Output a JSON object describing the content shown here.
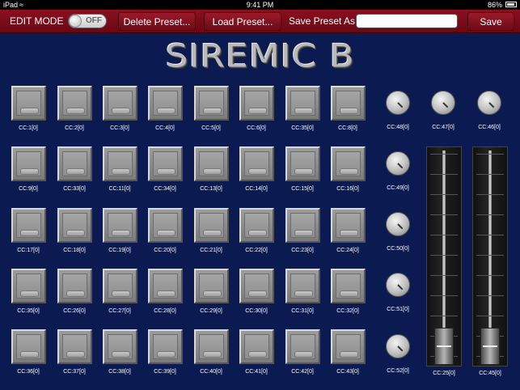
{
  "status": {
    "carrier": "iPad",
    "time": "9:41 PM",
    "battery": "86%"
  },
  "toolbar": {
    "edit_mode_label": "EDIT MODE",
    "toggle_state": "OFF",
    "delete_label": "Delete Preset...",
    "load_label": "Load Preset...",
    "save_as_label": "Save Preset As:",
    "preset_name_value": "",
    "save_label": "Save"
  },
  "title": "SIREMIC B",
  "pads": [
    [
      "CC:1[0]",
      "CC:2[0]",
      "CC:3[0]",
      "CC:4[0]",
      "CC:5[0]",
      "CC:6[0]",
      "CC:35[0]",
      "CC:8[0]"
    ],
    [
      "CC:9[0]",
      "CC:33[0]",
      "CC:11[0]",
      "CC:34[0]",
      "CC:13[0]",
      "CC:14[0]",
      "CC:15[0]",
      "CC:16[0]"
    ],
    [
      "CC:17[0]",
      "CC:18[0]",
      "CC:19[0]",
      "CC:20[0]",
      "CC:21[0]",
      "CC:22[0]",
      "CC:23[0]",
      "CC:24[0]"
    ],
    [
      "CC:35[0]",
      "CC:26[0]",
      "CC:27[0]",
      "CC:28[0]",
      "CC:29[0]",
      "CC:30[0]",
      "CC:31[0]",
      "CC:32[0]"
    ],
    [
      "CC:36[0]",
      "CC:37[0]",
      "CC:38[0]",
      "CC:39[0]",
      "CC:40[0]",
      "CC:41[0]",
      "CC:42[0]",
      "CC:43[0]"
    ]
  ],
  "knobs": {
    "top_row": [
      "CC:48[0]",
      "CC:47[0]",
      "CC:46[0]"
    ],
    "column": [
      "CC:49[0]",
      "CC:50[0]",
      "CC:51[0]",
      "CC:52[0]"
    ]
  },
  "faders": [
    {
      "label": "CC:25[0]",
      "level": 0
    },
    {
      "label": "CC:45[0]",
      "level": 0
    }
  ]
}
